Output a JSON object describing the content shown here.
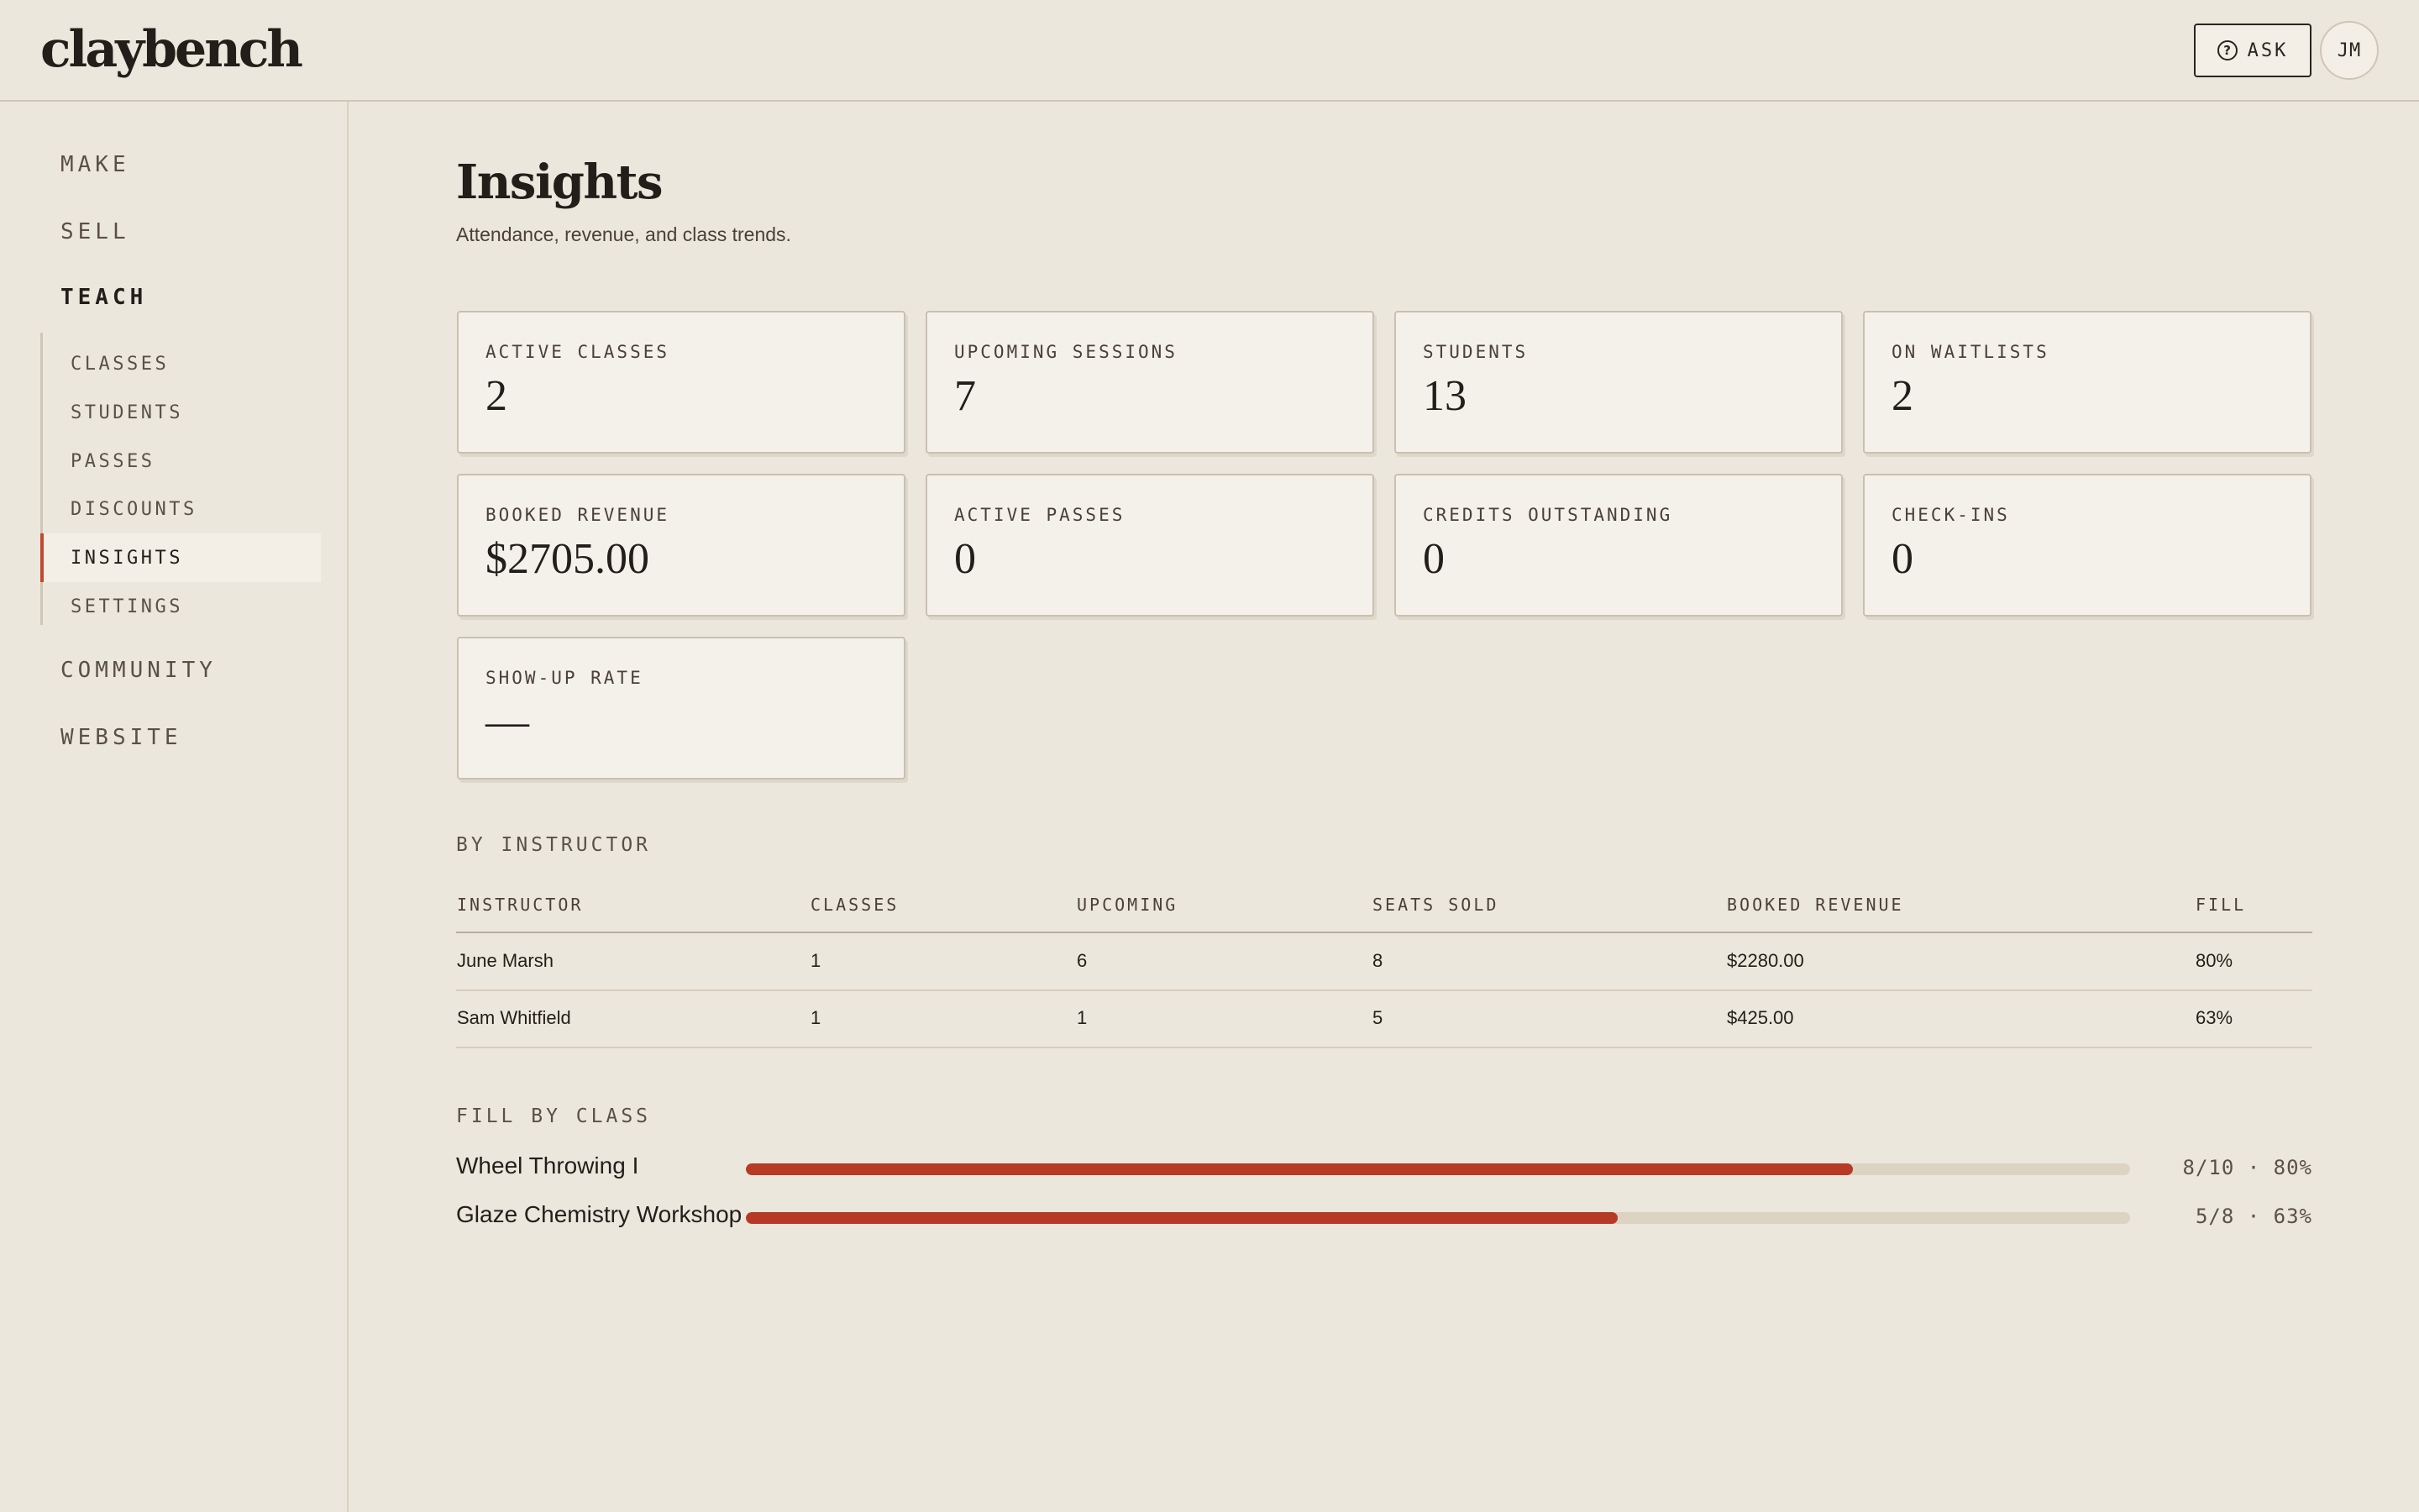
{
  "header": {
    "logo": "claybench",
    "ask_label": "ASK",
    "ask_icon": "help-circle-icon",
    "avatar_initials": "JM"
  },
  "sidebar": {
    "sections": [
      {
        "label": "MAKE"
      },
      {
        "label": "SELL"
      },
      {
        "label": "TEACH"
      },
      {
        "label": "COMMUNITY"
      },
      {
        "label": "WEBSITE"
      }
    ],
    "active_section": "TEACH",
    "teach_items": [
      {
        "label": "CLASSES"
      },
      {
        "label": "STUDENTS"
      },
      {
        "label": "PASSES"
      },
      {
        "label": "DISCOUNTS"
      },
      {
        "label": "INSIGHTS"
      },
      {
        "label": "SETTINGS"
      }
    ],
    "active_item": "INSIGHTS"
  },
  "page": {
    "title": "Insights",
    "subtitle": "Attendance, revenue, and class trends."
  },
  "stats": [
    {
      "label": "ACTIVE CLASSES",
      "value": "2"
    },
    {
      "label": "UPCOMING SESSIONS",
      "value": "7"
    },
    {
      "label": "STUDENTS",
      "value": "13"
    },
    {
      "label": "ON WAITLISTS",
      "value": "2"
    },
    {
      "label": "BOOKED REVENUE",
      "value": "$2705.00"
    },
    {
      "label": "ACTIVE PASSES",
      "value": "0"
    },
    {
      "label": "CREDITS OUTSTANDING",
      "value": "0"
    },
    {
      "label": "CHECK-INS",
      "value": "0"
    },
    {
      "label": "SHOW-UP RATE",
      "value": "—"
    }
  ],
  "by_instructor": {
    "heading": "BY INSTRUCTOR",
    "columns": [
      "INSTRUCTOR",
      "CLASSES",
      "UPCOMING",
      "SEATS SOLD",
      "BOOKED REVENUE",
      "FILL"
    ],
    "rows": [
      [
        "June Marsh",
        "1",
        "6",
        "8",
        "$2280.00",
        "80%"
      ],
      [
        "Sam Whitfield",
        "1",
        "1",
        "5",
        "$425.00",
        "63%"
      ]
    ]
  },
  "fill_by_class": {
    "heading": "FILL BY CLASS",
    "items": [
      {
        "name": "Wheel Throwing I",
        "stat": "8/10 · 80%",
        "fraction": 0.8
      },
      {
        "name": "Glaze Chemistry Workshop",
        "stat": "5/8 · 63%",
        "fraction": 0.63
      }
    ]
  },
  "colors": {
    "background": "#ECE7DC",
    "card": "#F4F1EA",
    "accent": "#B63A25",
    "text": "#231E1A"
  }
}
